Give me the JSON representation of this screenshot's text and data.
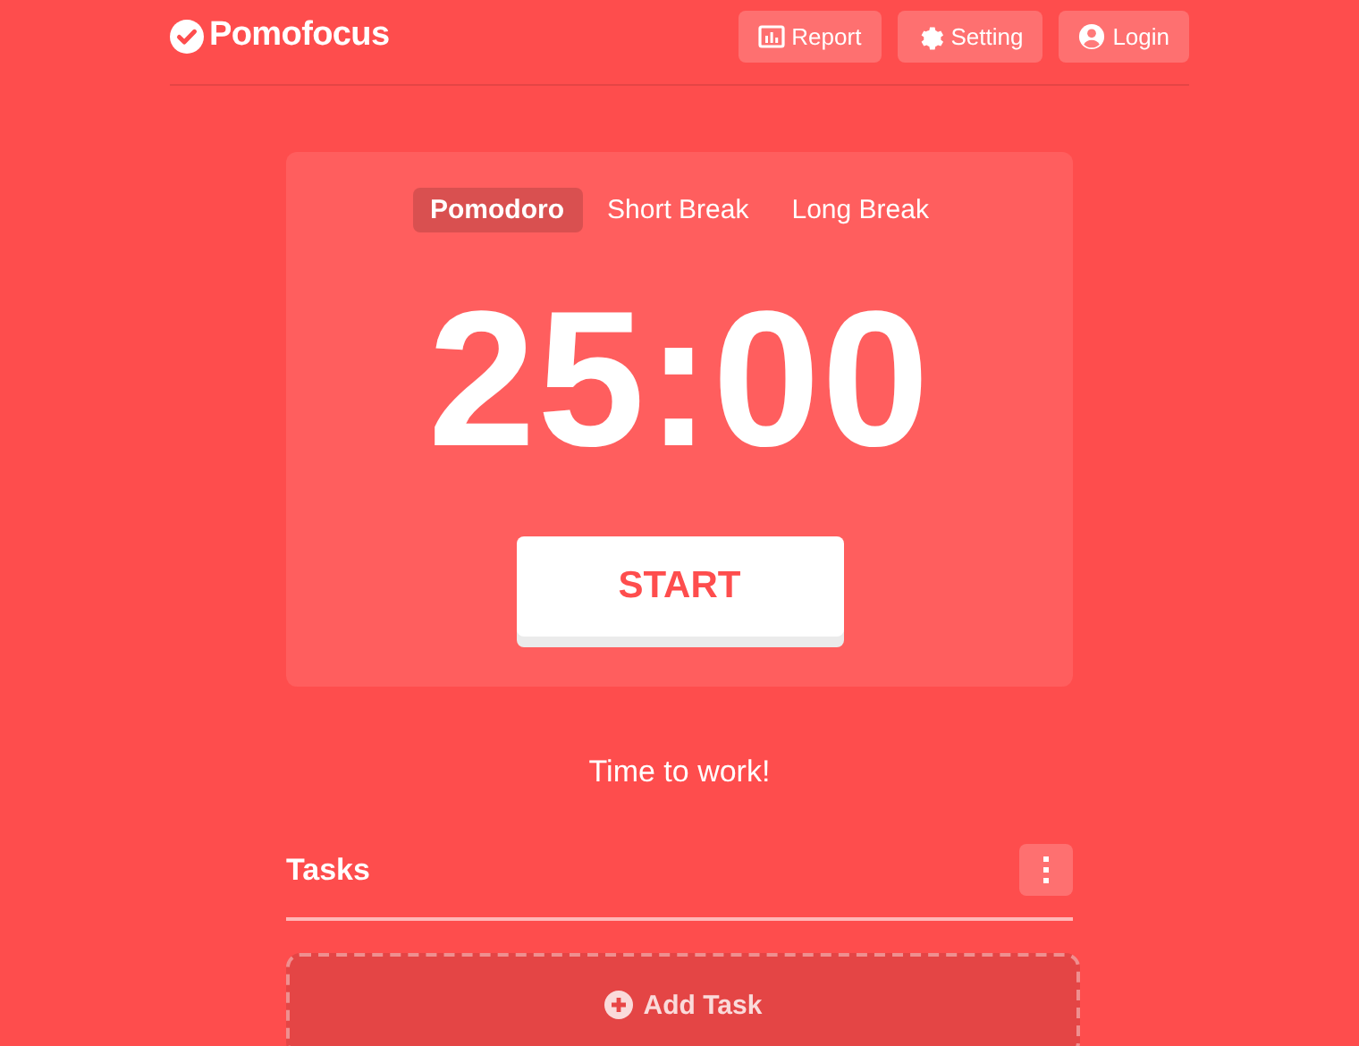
{
  "brand": {
    "name": "Pomofocus"
  },
  "nav": [
    {
      "label": "Report",
      "kind": "report"
    },
    {
      "label": "Setting",
      "kind": "setting"
    },
    {
      "label": "Login",
      "kind": "login"
    }
  ],
  "modes": [
    {
      "label": "Pomodoro",
      "selected": true
    },
    {
      "label": "Short Break",
      "selected": false
    },
    {
      "label": "Long Break",
      "selected": false
    }
  ],
  "timer": "25:00",
  "start_button": "START",
  "message": "Time to work!",
  "tasks": {
    "title": "Tasks",
    "add_label": "Add Task"
  }
}
